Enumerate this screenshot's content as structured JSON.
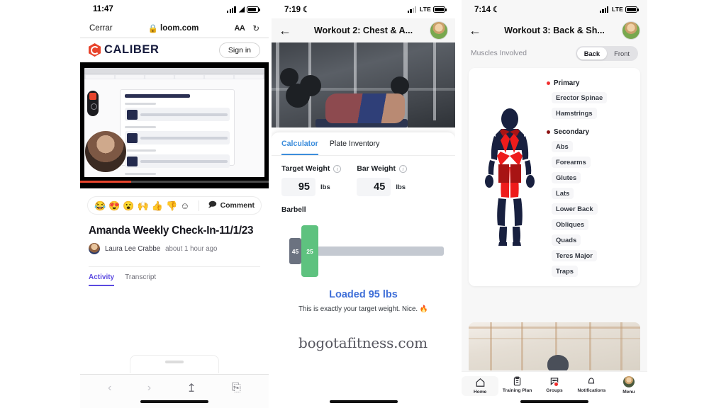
{
  "panel1": {
    "status": {
      "time": "11:47",
      "battery_icon": "battery-icon",
      "wifi_icon": "wifi-icon",
      "signal_icon": "signal-icon"
    },
    "browser": {
      "close_label": "Cerrar",
      "url": "loom.com",
      "lock_icon": "lock-icon",
      "text_size_label": "AA",
      "reload_icon": "reload-icon"
    },
    "site": {
      "brand": "CALIBER",
      "brand_color": "#e8442c",
      "signin_label": "Sign in"
    },
    "video": {
      "recorder_icon": "screen-recorder-icon",
      "camera_bubble": "presenter-avatar",
      "progress_percent": 27
    },
    "reactions": {
      "emojis": [
        "😂",
        "😍",
        "😮",
        "🙌",
        "👍",
        "👎"
      ],
      "add_icon": "add-reaction-icon",
      "comment_label": "Comment",
      "comment_icon": "comment-icon"
    },
    "post": {
      "title": "Amanda Weekly Check-In-11/1/23",
      "author": "Laura Lee Crabbe",
      "timestamp": "about 1 hour ago"
    },
    "tabs": [
      {
        "label": "Activity",
        "active": true
      },
      {
        "label": "Transcript",
        "active": false
      }
    ],
    "toolbar": {
      "back_icon": "back-chevron-icon",
      "forward_icon": "forward-chevron-icon",
      "share_icon": "share-icon",
      "compass_icon": "compass-icon"
    }
  },
  "watermark": "bogotafitness.com",
  "panel2": {
    "status": {
      "time": "7:19",
      "moon_icon": "moon-icon",
      "carrier": "LTE",
      "battery_icon": "battery-icon"
    },
    "header": {
      "back_icon": "back-arrow-icon",
      "title": "Workout 2: Chest & A...",
      "avatar": "user-avatar"
    },
    "photo": "bench-press-photo",
    "tabs": [
      {
        "label": "Calculator",
        "active": true
      },
      {
        "label": "Plate Inventory",
        "active": false
      }
    ],
    "fields": [
      {
        "label": "Target Weight",
        "value": "95",
        "unit": "lbs",
        "info_icon": "info-icon"
      },
      {
        "label": "Bar Weight",
        "value": "45",
        "unit": "lbs",
        "info_icon": "info-icon"
      }
    ],
    "barbell": {
      "label": "Barbell",
      "plates": [
        {
          "value": "45",
          "color": "#6b7280"
        },
        {
          "value": "25",
          "color": "#5ec27f"
        }
      ]
    },
    "result": {
      "headline": "Loaded 95 lbs",
      "subtext": "This is exactly your target weight. Nice. 🔥",
      "accent_color": "#3f6fd8"
    }
  },
  "panel3": {
    "status": {
      "time": "7:14",
      "moon_icon": "moon-icon",
      "carrier": "LTE",
      "battery_icon": "battery-icon"
    },
    "header": {
      "back_icon": "back-arrow-icon",
      "title": "Workout 3: Back & Sh...",
      "avatar": "user-avatar"
    },
    "section": {
      "label": "Muscles Involved"
    },
    "segmented": [
      {
        "label": "Back",
        "active": true
      },
      {
        "label": "Front",
        "active": false
      }
    ],
    "figure": "anatomy-back-view",
    "groups": [
      {
        "heading": "Primary",
        "dot_color": "#f12f2f",
        "muscles": [
          "Erector Spinae",
          "Hamstrings"
        ]
      },
      {
        "heading": "Secondary",
        "dot_color": "#8c1212",
        "muscles": [
          "Abs",
          "Forearms",
          "Glutes",
          "Lats",
          "Lower Back",
          "Obliques",
          "Quads",
          "Teres Major",
          "Traps"
        ]
      }
    ],
    "bottom_photo": "gym-interior-photo",
    "nav": [
      {
        "label": "Home",
        "icon": "home-icon",
        "active": true,
        "badge": false
      },
      {
        "label": "Training Plan",
        "icon": "clipboard-icon",
        "active": false,
        "badge": false
      },
      {
        "label": "Groups",
        "icon": "chat-bubble-icon",
        "active": false,
        "badge": true
      },
      {
        "label": "Notifications",
        "icon": "bell-icon",
        "active": false,
        "badge": false
      },
      {
        "label": "Menu",
        "icon": "avatar-icon",
        "active": false,
        "badge": false
      }
    ]
  }
}
